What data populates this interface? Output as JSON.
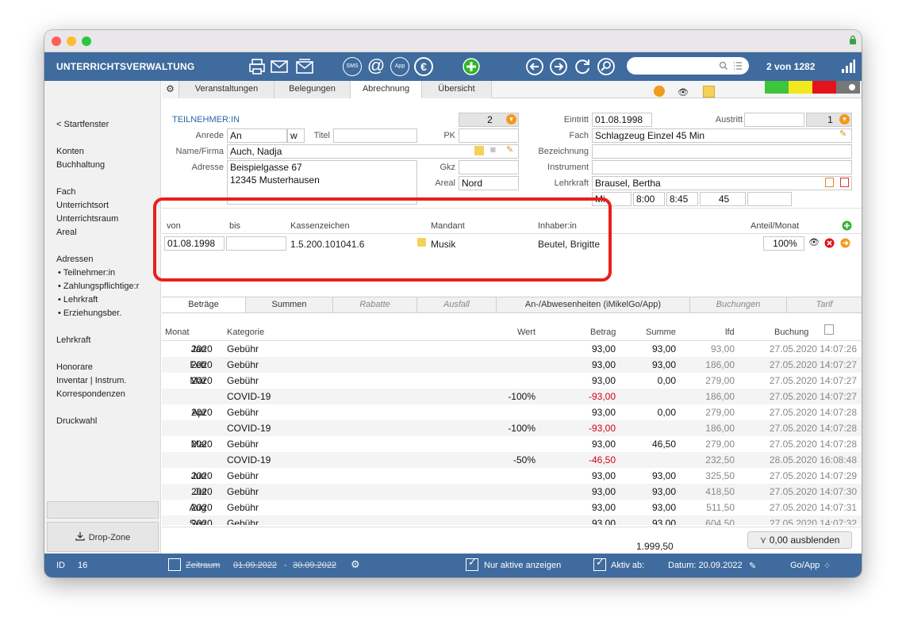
{
  "window": {
    "lock_icon": "lock-icon"
  },
  "toolbar": {
    "title": "UNTERRICHTSVERWALTUNG",
    "icons": [
      "printer-icon",
      "mail-icon",
      "mail-open-icon",
      "sms-icon",
      "at-icon",
      "app-icon",
      "euro-icon",
      "add-icon",
      "back-icon",
      "forward-icon",
      "refresh-icon",
      "search-icon"
    ],
    "sms": "SMS",
    "app": "App",
    "counter": "2 von 1282",
    "search_placeholder": ""
  },
  "sidebar": {
    "back": "< Startfenster",
    "items": [
      "Konten",
      "Buchhaltung",
      "Fach",
      "Unterrichtsort",
      "Unterrichtsraum",
      "Areal",
      "Adressen"
    ],
    "sub": [
      "• Teilnehmer:in",
      "• Zahlungspflichtige:r",
      "• Lehrkraft",
      "• Erziehungsber."
    ],
    "more": [
      "Lehrkraft",
      "Honorare",
      "Inventar | Instrum.",
      "Korrespondenzen",
      "Druckwahl"
    ],
    "dropzone": "Drop-Zone"
  },
  "tabs_top": [
    "Veranstaltungen",
    "Belegungen",
    "Abrechnung",
    "Übersicht"
  ],
  "form": {
    "section_title": "TEILNEHMER:IN",
    "tn_number": "2",
    "anrede_label": "Anrede",
    "anrede": "An",
    "anrede_w": "w",
    "titel_label": "Titel",
    "titel": "",
    "pk_label": "PK",
    "pk": "",
    "name_label": "Name/Firma",
    "name": "Auch, Nadja",
    "adresse_label": "Adresse",
    "adresse1": "Beispielgasse 67",
    "adresse2": "12345 Musterhausen",
    "gkz_label": "Gkz",
    "gkz": "",
    "areal_label": "Areal",
    "areal": "Nord",
    "eintritt_label": "Eintritt",
    "eintritt": "01.08.1998",
    "austritt_label": "Austritt",
    "austritt": "",
    "austritt_num": "1",
    "fach_label": "Fach",
    "fach": "Schlagzeug Einzel 45 Min",
    "bezeichnung_label": "Bezeichnung",
    "bezeichnung": "",
    "instrument_label": "Instrument",
    "instrument": "",
    "lehrkraft_label": "Lehrkraft",
    "lehrkraft": "Brausel, Bertha",
    "tag": "Mi",
    "von": "8:00",
    "bis": "8:45",
    "dauer": "45"
  },
  "status_colors": [
    "#3ec53c",
    "#f3e81b",
    "#e3131c",
    "#777777"
  ],
  "zahlung": {
    "headers": [
      "von",
      "bis",
      "Kassenzeichen",
      "Mandant",
      "Inhaber:in",
      "Anteil/Monat"
    ],
    "row": {
      "von": "01.08.1998",
      "bis": "",
      "kassenzeichen": "1.5.200.101041.6",
      "mandant": "Musik",
      "inhaber": "Beutel, Brigitte",
      "anteil": "100%"
    }
  },
  "tabs_bottom": [
    "Beträge",
    "Summen",
    "Rabatte",
    "Ausfall",
    "An-/Abwesenheiten (iMikelGo/App)",
    "Buchungen",
    "Tarif"
  ],
  "table": {
    "headers": [
      "Monat",
      "Kategorie",
      "Wert",
      "Betrag",
      "Summe",
      "lfd",
      "Buchung"
    ],
    "rows": [
      {
        "m": "Jan",
        "y": "2020",
        "k": "Gebühr",
        "w": "",
        "b": "93,00",
        "s": "93,00",
        "l": "93,00",
        "d": "27.05.2020 14:07:26",
        "neg": false
      },
      {
        "m": "Feb",
        "y": "2020",
        "k": "Gebühr",
        "w": "",
        "b": "93,00",
        "s": "93,00",
        "l": "186,00",
        "d": "27.05.2020 14:07:27",
        "neg": false
      },
      {
        "m": "Mär",
        "y": "2020",
        "k": "Gebühr",
        "w": "",
        "b": "93,00",
        "s": "0,00",
        "l": "279,00",
        "d": "27.05.2020 14:07:27",
        "neg": false
      },
      {
        "m": "",
        "y": "",
        "k": "COVID-19",
        "w": "-100%",
        "b": "-93,00",
        "s": "",
        "l": "186,00",
        "d": "27.05.2020 14:07:27",
        "neg": true
      },
      {
        "m": "Apr",
        "y": "2020",
        "k": "Gebühr",
        "w": "",
        "b": "93,00",
        "s": "0,00",
        "l": "279,00",
        "d": "27.05.2020 14:07:28",
        "neg": false
      },
      {
        "m": "",
        "y": "",
        "k": "COVID-19",
        "w": "-100%",
        "b": "-93,00",
        "s": "",
        "l": "186,00",
        "d": "27.05.2020 14:07:28",
        "neg": true
      },
      {
        "m": "Mai",
        "y": "2020",
        "k": "Gebühr",
        "w": "",
        "b": "93,00",
        "s": "46,50",
        "l": "279,00",
        "d": "27.05.2020 14:07:28",
        "neg": false
      },
      {
        "m": "",
        "y": "",
        "k": "COVID-19",
        "w": "-50%",
        "b": "-46,50",
        "s": "",
        "l": "232,50",
        "d": "28.05.2020 16:08:48",
        "neg": true
      },
      {
        "m": "Jun",
        "y": "2020",
        "k": "Gebühr",
        "w": "",
        "b": "93,00",
        "s": "93,00",
        "l": "325,50",
        "d": "27.05.2020 14:07:29",
        "neg": false
      },
      {
        "m": "Jul",
        "y": "2020",
        "k": "Gebühr",
        "w": "",
        "b": "93,00",
        "s": "93,00",
        "l": "418,50",
        "d": "27.05.2020 14:07:30",
        "neg": false
      },
      {
        "m": "Aug",
        "y": "2020",
        "k": "Gebühr",
        "w": "",
        "b": "93,00",
        "s": "93,00",
        "l": "511,50",
        "d": "27.05.2020 14:07:31",
        "neg": false
      },
      {
        "m": "Sep",
        "y": "2020",
        "k": "Gebühr",
        "w": "",
        "b": "93,00",
        "s": "93,00",
        "l": "604,50",
        "d": "27.05.2020 14:07:32",
        "neg": false
      }
    ],
    "total": "1.999,50",
    "hide_button": "0,00 ausblenden"
  },
  "statusbar": {
    "id_label": "ID",
    "id": "16",
    "zeitraum": "Zeitraum",
    "from": "01.09.2022",
    "sep": "-",
    "to": "30.09.2022",
    "nur_aktive": "Nur aktive anzeigen",
    "aktiv_ab": "Aktiv ab:",
    "datum": "Datum: 20.09.2022",
    "goapp": "Go/App"
  }
}
